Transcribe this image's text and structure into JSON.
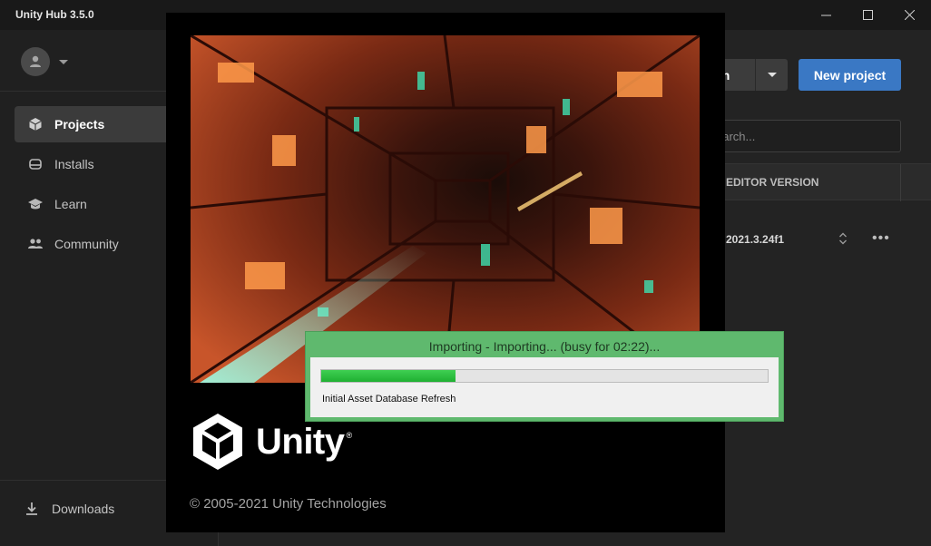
{
  "window": {
    "title": "Unity Hub 3.5.0",
    "controls": [
      "minimize-icon",
      "maximize-icon",
      "close-icon"
    ]
  },
  "sidebar": {
    "items": [
      {
        "label": "Projects",
        "icon": "cube-icon",
        "active": true
      },
      {
        "label": "Installs",
        "icon": "install-icon",
        "active": false
      },
      {
        "label": "Learn",
        "icon": "graduation-cap-icon",
        "active": false
      },
      {
        "label": "Community",
        "icon": "people-icon",
        "active": false
      }
    ],
    "downloads_label": "Downloads"
  },
  "toolbar": {
    "open_label_partial": "en",
    "new_project_label": "New project"
  },
  "search": {
    "placeholder_partial": "earch..."
  },
  "table": {
    "editor_version_header": "EDITOR VERSION",
    "rows": [
      {
        "editor_version": "2021.3.24f1",
        "more": "•••"
      }
    ]
  },
  "splash": {
    "logo_text": "Unity",
    "logo_mark": "®",
    "copyright": "© 2005-2021 Unity Technologies"
  },
  "progress": {
    "title": "Importing - Importing... (busy for 02:22)...",
    "status": "Initial Asset Database Refresh",
    "fraction": 0.3
  },
  "colors": {
    "accent": "#3a78c4",
    "progress_frame": "#5fb96e",
    "progress_fill": "#1fb032"
  }
}
